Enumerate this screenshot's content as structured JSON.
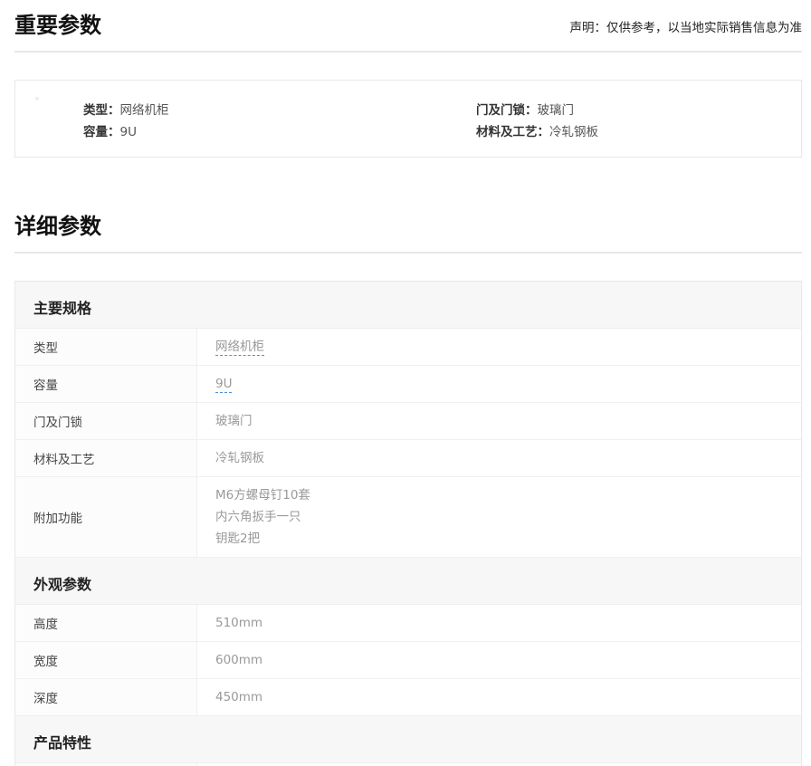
{
  "important": {
    "title": "重要参数",
    "disclaimer": "声明：仅供参考，以当地实际销售信息为准",
    "items": [
      {
        "key": "类型：",
        "value": "网络机柜"
      },
      {
        "key": "容量：",
        "value": "9U"
      },
      {
        "key": "门及门锁：",
        "value": "玻璃门"
      },
      {
        "key": "材料及工艺：",
        "value": "冷轧钢板"
      }
    ]
  },
  "detail": {
    "title": "详细参数",
    "groups": [
      {
        "name": "主要规格",
        "rows": [
          {
            "key": "类型",
            "values": [
              "网络机柜"
            ]
          },
          {
            "key": "容量",
            "values": [
              "9U"
            ]
          },
          {
            "key": "门及门锁",
            "values": [
              "玻璃门"
            ]
          },
          {
            "key": "材料及工艺",
            "values": [
              "冷轧钢板"
            ]
          },
          {
            "key": "附加功能",
            "values": [
              "M6方螺母钉10套",
              "内六角扳手一只",
              "钥匙2把"
            ]
          }
        ]
      },
      {
        "name": "外观参数",
        "rows": [
          {
            "key": "高度",
            "values": [
              "510mm"
            ]
          },
          {
            "key": "宽度",
            "values": [
              "600mm"
            ]
          },
          {
            "key": "深度",
            "values": [
              "450mm"
            ]
          }
        ]
      },
      {
        "name": "产品特性",
        "rows": []
      }
    ]
  },
  "colors": {
    "link_underline": "#4a90d9",
    "value_text": "#999999",
    "group_bg": "#f7f7f7"
  }
}
